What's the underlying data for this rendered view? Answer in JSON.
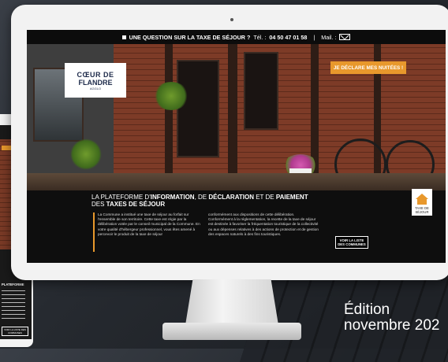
{
  "topbar": {
    "question": "UNE QUESTION SUR LA TAXE DE SÉJOUR ?",
    "tel_label": "Tél. :",
    "phone": "04 50 47 01 58",
    "separator": "|",
    "mail_label": "Mail. :"
  },
  "logo": {
    "line1": "CŒUR DE",
    "line2": "FLANDRE",
    "line3": "AGGLO"
  },
  "declare_button": "JE DÉCLARE MES NUITÉES !",
  "taxe_badge": {
    "line1": "TAXE DE",
    "line2": "SÉJOUR"
  },
  "info": {
    "title_1": "LA PLATEFORME D'",
    "title_2": "INFORMATION",
    "title_3": ", DE ",
    "title_4": "DÉCLARATION",
    "title_5": " ET DE ",
    "title_6": "PAIEMENT",
    "title_7": "DES ",
    "title_8": "TAXES DE SÉJOUR",
    "col_left": "La Commune a institué une taxe de séjour au forfait sur l'ensemble de son territoire. Cette taxe est régie par la délibération votée par le conseil municipal de la Commune. En votre qualité d'hébergeur professionnel, vous êtes amené à percevoir le produit de la taxe de séjour",
    "col_right": "conformément aux dispositions de cette délibération. Conformément à la réglementation, la recette de la taxe de séjour est destinée à favoriser la fréquentation touristique de la collectivité ou aux dépenses relatives à des actions de protection et de gestion des espaces naturels à des fins touristiques.",
    "list_button": "VOIR LA LISTE DES COMMUNES"
  },
  "phone": {
    "heading": "PLATEFORME",
    "button": "VOIR LA LISTE DES COMMUNES"
  },
  "edition": {
    "line1": "Édition",
    "line2": "novembre 202"
  },
  "colors": {
    "accent": "#e8982c",
    "dark": "#0e0e0e",
    "brand_navy": "#1d2a4a"
  }
}
